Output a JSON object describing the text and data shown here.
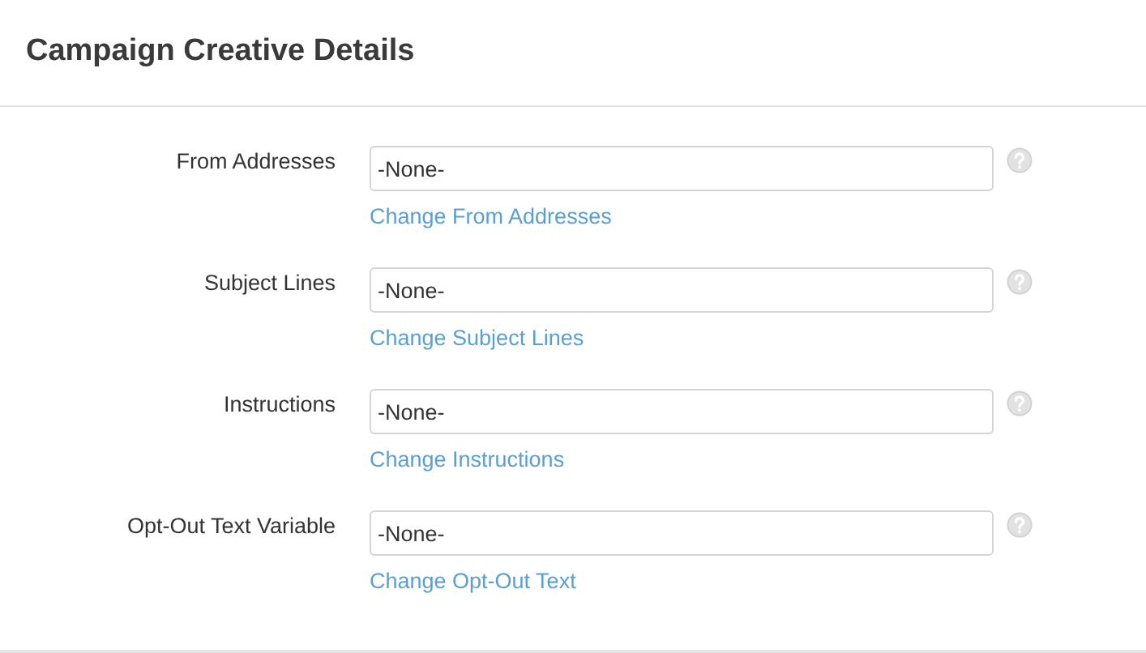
{
  "panel": {
    "title": "Campaign Creative Details"
  },
  "fields": [
    {
      "label": "From Addresses",
      "value": "-None-",
      "link": "Change From Addresses"
    },
    {
      "label": "Subject Lines",
      "value": "-None-",
      "link": "Change Subject Lines"
    },
    {
      "label": "Instructions",
      "value": "-None-",
      "link": "Change Instructions"
    },
    {
      "label": "Opt-Out Text Variable",
      "value": "-None-",
      "link": "Change Opt-Out Text"
    }
  ]
}
